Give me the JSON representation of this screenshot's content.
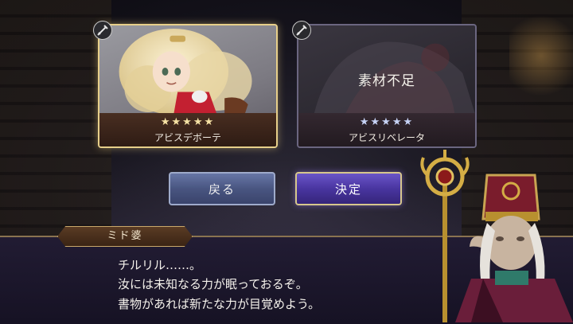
{
  "cards": [
    {
      "name": "アビスデボーテ",
      "stars": "★★★★★",
      "selected": true
    },
    {
      "name": "アビスリベレータ",
      "stars": "★★★★★",
      "status": "素材不足"
    }
  ],
  "buttons": {
    "back": "戻る",
    "confirm": "決定"
  },
  "dialog": {
    "speaker": "ミド婆",
    "lines": [
      "チルリル……。",
      "汝には未知なる力が眠っておるぞ。",
      "書物があれば新たな力が目覚めよう。"
    ]
  },
  "icons": {
    "card_badge": "sword-icon",
    "npc_staff": "staff-icon"
  },
  "colors": {
    "selected_border": "#e7cf8a",
    "confirm_button": "#4935a0",
    "back_button": "#4c5a88"
  }
}
